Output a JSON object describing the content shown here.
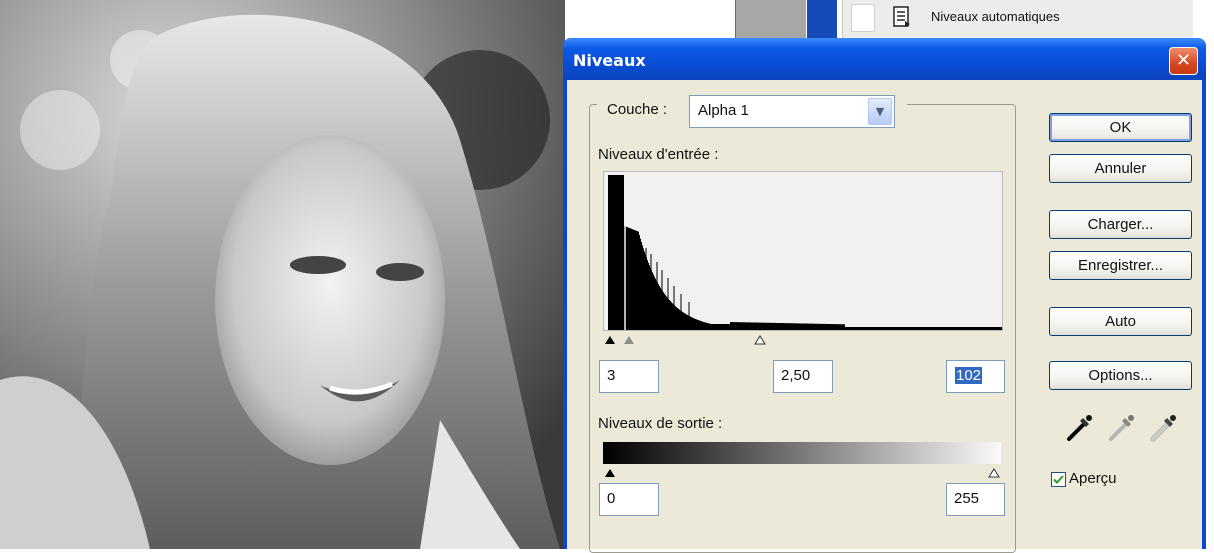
{
  "app_panel": {
    "action_label": "Niveaux automatiques"
  },
  "dialog": {
    "title": "Niveaux",
    "close_glyph": "✕",
    "channel_label": "Couche :",
    "channel_value": "Alpha 1",
    "input_levels_label": "Niveaux d'entrée :",
    "input_black": "3",
    "input_gamma": "2,50",
    "input_white": "102",
    "output_levels_label": "Niveaux de sortie :",
    "output_black": "0",
    "output_white": "255",
    "buttons": {
      "ok": "OK",
      "cancel": "Annuler",
      "load": "Charger...",
      "save": "Enregistrer...",
      "auto": "Auto",
      "options": "Options..."
    },
    "preview_label": "Aperçu",
    "preview_checked": true
  },
  "icons": {
    "close": "close-icon",
    "dropdown": "chevron-down-icon",
    "eyedroppers": [
      "black-eyedropper-icon",
      "gray-eyedropper-icon",
      "white-eyedropper-icon"
    ],
    "panel_action": "document-icon"
  },
  "colors": {
    "title_bar": "#0a4ad0",
    "dialog_face": "#ece9d8",
    "close_button": "#d8461f",
    "selection": "#316ac5"
  }
}
